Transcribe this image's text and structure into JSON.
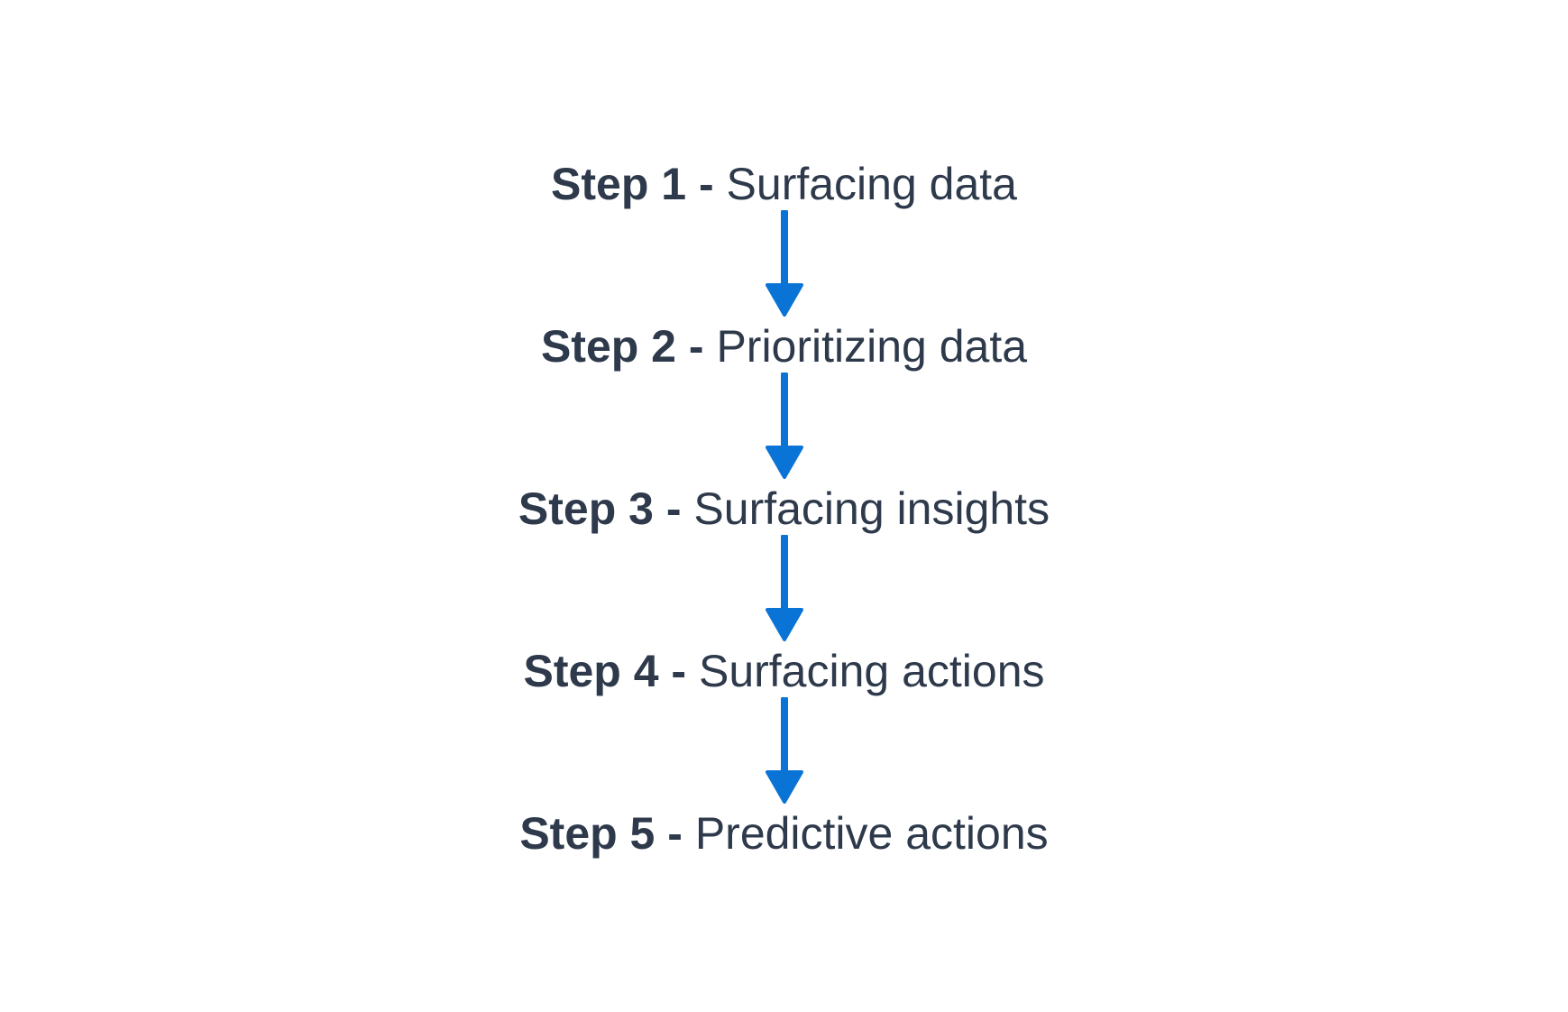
{
  "colors": {
    "text": "#2e3a4b",
    "arrow": "#0a74d6",
    "background": "#ffffff"
  },
  "steps": [
    {
      "number": "Step 1 -",
      "label": "Surfacing data"
    },
    {
      "number": "Step 2 -",
      "label": "Prioritizing data"
    },
    {
      "number": "Step 3 -",
      "label": "Surfacing insights"
    },
    {
      "number": "Step 4 -",
      "label": "Surfacing actions"
    },
    {
      "number": "Step 5 -",
      "label": "Predictive actions"
    }
  ],
  "arrows": [
    {
      "icon": "arrow-down-icon"
    },
    {
      "icon": "arrow-down-icon"
    },
    {
      "icon": "arrow-down-icon"
    },
    {
      "icon": "arrow-down-icon"
    }
  ]
}
